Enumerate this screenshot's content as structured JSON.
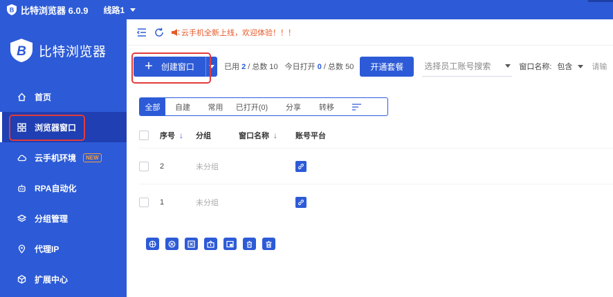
{
  "titlebar": {
    "app_title": "比特浏览器 6.0.9",
    "line_label": "线路1"
  },
  "sidebar": {
    "brand": "比特浏览器",
    "items": [
      {
        "label": "首页",
        "icon": "home-icon"
      },
      {
        "label": "浏览器窗口",
        "icon": "grid-icon",
        "active": true
      },
      {
        "label": "云手机环境",
        "icon": "cloud-phone-icon",
        "badge": "NEW"
      },
      {
        "label": "RPA自动化",
        "icon": "robot-icon"
      },
      {
        "label": "分组管理",
        "icon": "layers-icon"
      },
      {
        "label": "代理IP",
        "icon": "location-pin-icon"
      },
      {
        "label": "扩展中心",
        "icon": "puzzle-icon"
      }
    ]
  },
  "notice": {
    "text": "云手机全新上线，欢迎体验！！！"
  },
  "toolbar": {
    "create_label": "创建窗口",
    "used_prefix": "已用",
    "used_value": "2",
    "total_text": "/ 总数 10",
    "opened_prefix": "今日打开",
    "opened_value": "0",
    "opened_total_text": "/ 总数 50",
    "open_plan_label": "开通套餐",
    "employee_placeholder": "选择员工账号搜索",
    "window_name_label": "窗口名称:",
    "match_mode": "包含",
    "keyword_placeholder": "请输"
  },
  "tabs": [
    "全部",
    "自建",
    "常用",
    "已打开(0)",
    "分享",
    "转移"
  ],
  "table": {
    "headers": {
      "no": "序号",
      "group": "分组",
      "name": "窗口名称",
      "platform": "账号平台"
    },
    "rows": [
      {
        "no": "2",
        "group": "未分组",
        "name": ""
      },
      {
        "no": "1",
        "group": "未分组",
        "name": ""
      }
    ]
  },
  "actions": [
    "open-all-icon",
    "close-all-icon",
    "clear-cache-icon",
    "import-icon",
    "window-arrange-icon",
    "recycle-icon",
    "delete-icon"
  ],
  "colors": {
    "primary": "#2d5bd7",
    "sidebar_active": "#1f3fb3",
    "notice": "#e85a2a",
    "highlight": "#e23b3b"
  }
}
